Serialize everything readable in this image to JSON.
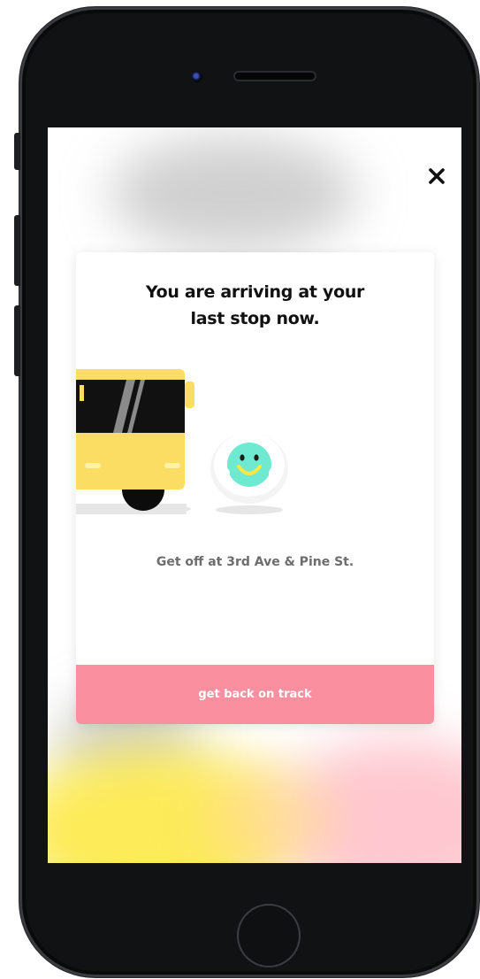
{
  "dialog": {
    "title_line1": "You are arriving at your",
    "title_line2": "last stop now.",
    "subtitle": "Get off at 3rd Ave & Pine St.",
    "cta_label": "get back on track"
  },
  "icons": {
    "close": "close-icon",
    "bus": "bus-illustration",
    "mascot": "smiley-mascot-icon"
  },
  "colors": {
    "cta_background": "#f98f9f",
    "bus_yellow": "#fcdd63",
    "mascot_face": "#6fe9cf",
    "title_text": "#111111",
    "subtitle_text": "#6d6d6d"
  }
}
